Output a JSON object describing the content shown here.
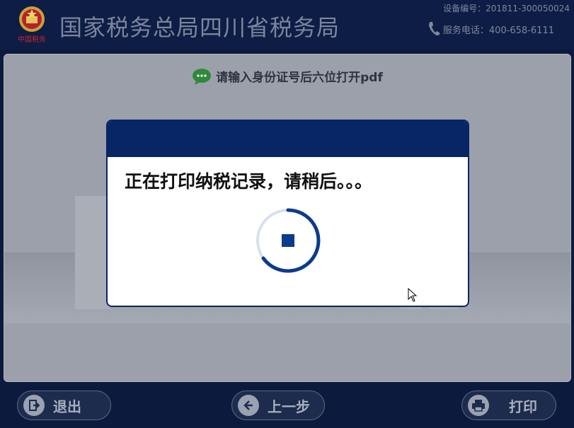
{
  "header": {
    "title": "国家税务总局四川省税务局",
    "logo_caption": "中国税务",
    "device_no": "设备编号：201811-300050024",
    "service_phone": "服务电话：400-658-6111"
  },
  "main": {
    "prompt": "请输入身份证号后六位打开pdf"
  },
  "modal": {
    "message": "正在打印纳税记录，请稍后。。。"
  },
  "footer": {
    "exit_label": "退出",
    "back_label": "上一步",
    "print_label": "打印"
  },
  "colors": {
    "header_bg": "#0d1d45",
    "modal_header": "#082566",
    "spinner": "#0b3b8c",
    "footer_bg": "#0b1a3d"
  }
}
